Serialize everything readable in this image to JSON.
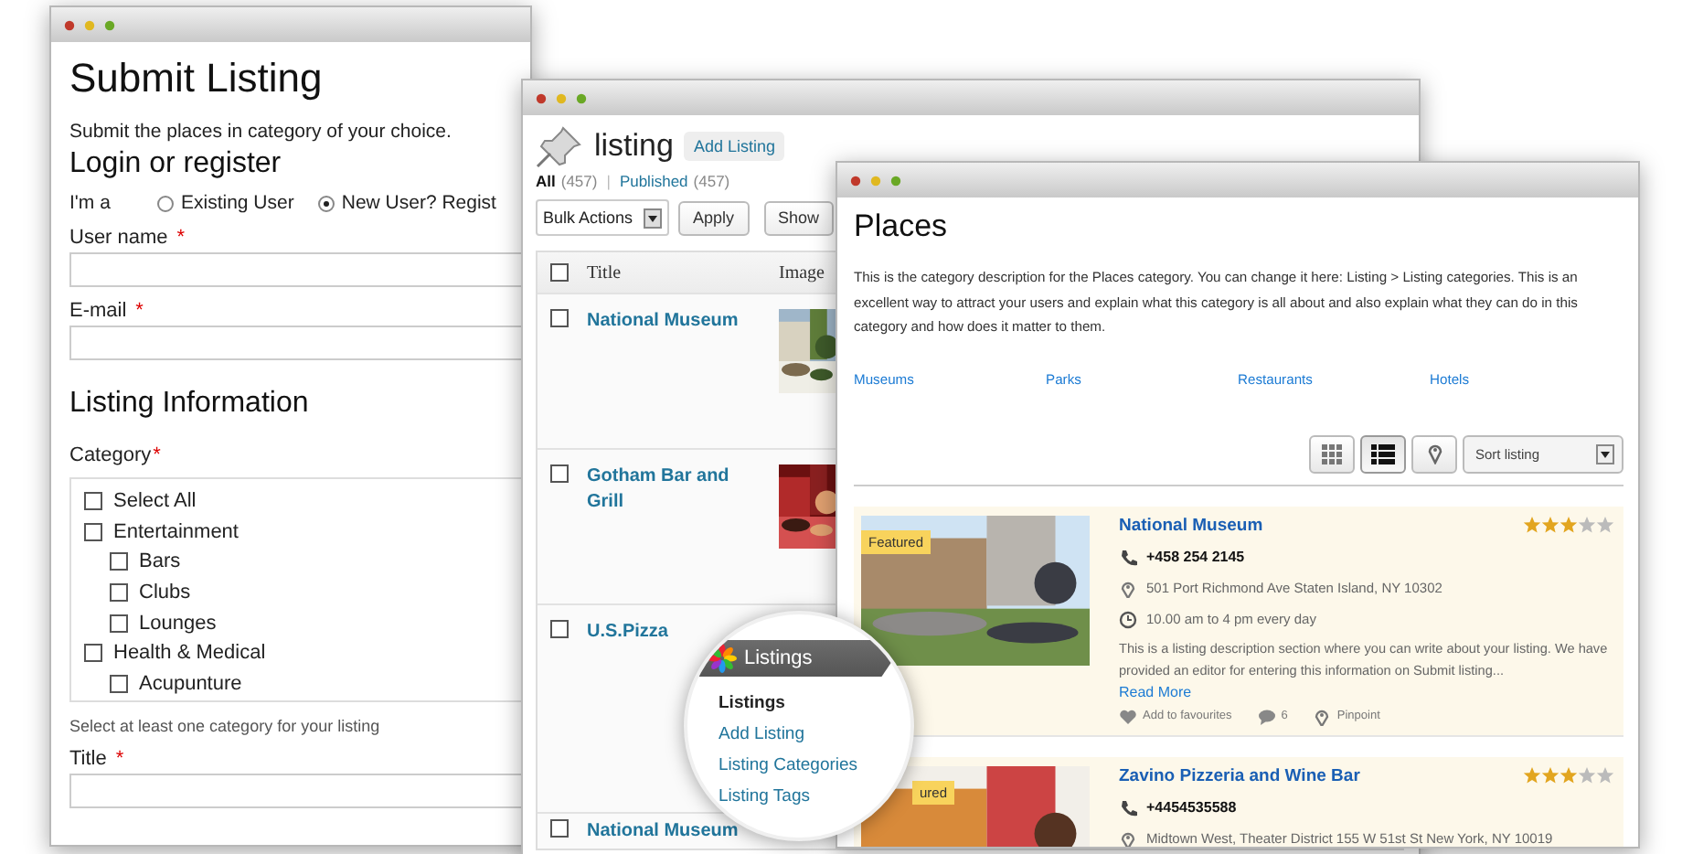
{
  "submit_window": {
    "title": "Submit Listing",
    "description": "Submit the places in category of your choice.",
    "login_heading": "Login or register",
    "user_type": {
      "label": "I'm a",
      "options": [
        {
          "label": "Existing User",
          "selected": false
        },
        {
          "label": "New User? Regist",
          "selected": true
        }
      ]
    },
    "fields": [
      {
        "label": "User name",
        "required_mark": "*"
      },
      {
        "label": "E-mail",
        "required_mark": "*"
      }
    ],
    "listing_heading": "Listing Information",
    "category": {
      "label": "Category",
      "required_mark": "*",
      "items": [
        {
          "label": "Select All",
          "checked": false
        },
        {
          "label": "Entertainment",
          "checked": false,
          "children": [
            {
              "label": "Bars",
              "checked": false
            },
            {
              "label": "Clubs",
              "checked": false
            },
            {
              "label": "Lounges",
              "checked": false
            }
          ]
        },
        {
          "label": "Health & Medical",
          "checked": false,
          "children": [
            {
              "label": "Acupunture",
              "checked": false
            }
          ]
        }
      ],
      "hint": "Select at least one category for your listing"
    },
    "title_field": {
      "label": "Title",
      "required_mark": "*"
    }
  },
  "admin_window": {
    "title": "listing",
    "add_button": "Add Listing",
    "filters": [
      {
        "label": "All",
        "count": "(457)",
        "selected": true
      },
      {
        "label": "Published",
        "count": "(457)",
        "selected": false
      }
    ],
    "separator": "|",
    "select_all_checked": false,
    "bulk_select": "Bulk Actions",
    "apply_button": "Apply",
    "show_button": "Show",
    "columns": [
      "Title",
      "Image"
    ],
    "rows": [
      {
        "title": "National Museum",
        "checked": false
      },
      {
        "title": "Gotham Bar and Grill",
        "checked": false
      },
      {
        "title": "U.S.Pizza",
        "checked": false
      },
      {
        "title": "National Museum",
        "checked": false
      }
    ]
  },
  "places_window": {
    "title": "Places",
    "description": "This is the category description for the Places category. You can change it here: Listing > Listing categories. This is an excellent way to attract your users and explain what this category is all about and also explain what they can do in this category and how does it matter to them.",
    "category_links": [
      "Museums",
      "Parks",
      "Restaurants",
      "Hotels"
    ],
    "view_buttons": [
      {
        "kind": "grid",
        "selected": false
      },
      {
        "kind": "list",
        "selected": true
      },
      {
        "kind": "map",
        "selected": false
      }
    ],
    "sort_select": "Sort listing",
    "listings": [
      {
        "title": "National Museum",
        "badge": "Featured",
        "stars": 3,
        "phone": "+458 254 2145",
        "address": "501 Port Richmond Ave Staten Island, NY 10302",
        "hours": "10.00 am to 4 pm every day",
        "description": "This is a listing description section where you can write about your listing. We have provided an editor for entering this information on Submit listing...",
        "read_more": "Read More",
        "actions": [
          {
            "kind": "favourite",
            "label": "Add to favourites"
          },
          {
            "kind": "comments",
            "label": "6"
          },
          {
            "kind": "pinpoint",
            "label": "Pinpoint"
          }
        ]
      },
      {
        "title": "Zavino Pizzeria and Wine Bar",
        "badge": "ured",
        "stars": 3,
        "phone": "+4454535588",
        "address": "Midtown West, Theater District 155 W 51st St New York, NY 10019"
      }
    ]
  },
  "admin_menu": {
    "heading": "Listings",
    "items": [
      {
        "label": "Listings",
        "selected": true
      },
      {
        "label": "Add Listing",
        "selected": false
      },
      {
        "label": "Listing Categories",
        "selected": false
      },
      {
        "label": "Listing Tags",
        "selected": false
      }
    ]
  }
}
